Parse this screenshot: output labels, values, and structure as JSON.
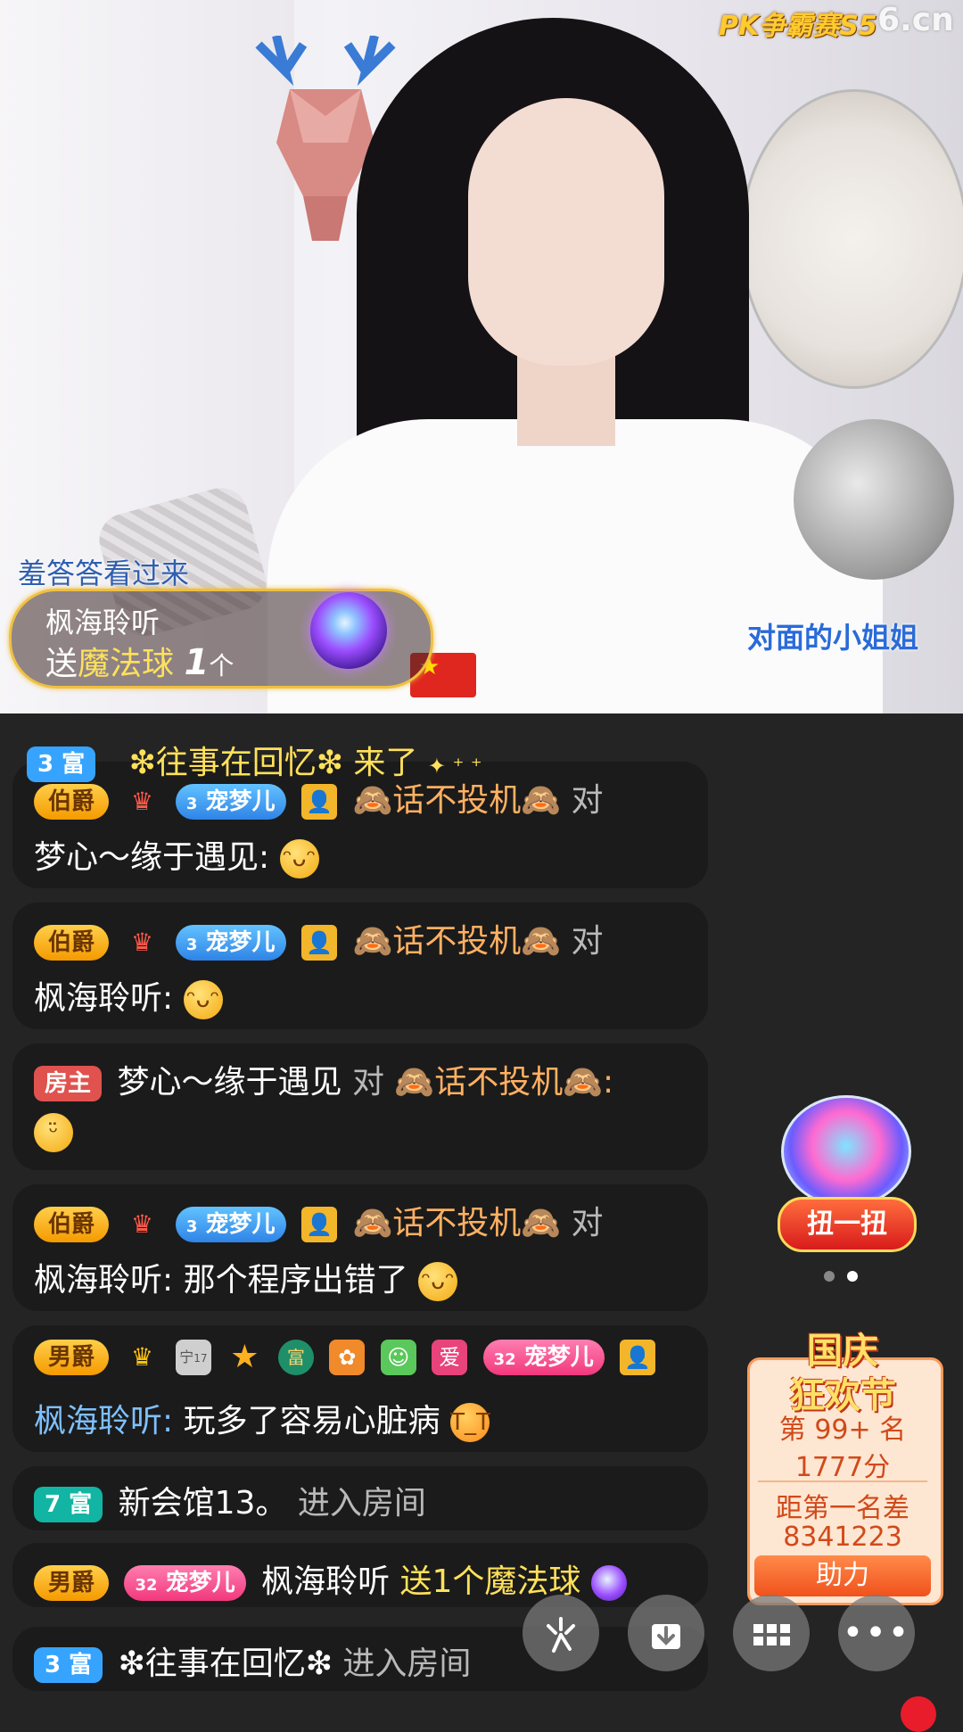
{
  "stream": {
    "pk_badge": "PK争霸赛S5",
    "site_logo": "6.cn",
    "watermark_left": "羞答答看过来",
    "watermark_right": "对面的小姐姐"
  },
  "gift_banner": {
    "sender": "枫海聆听",
    "verb": "送",
    "gift_name": "魔法球",
    "count": "1",
    "unit": "个"
  },
  "entry_banner": {
    "rich_level": "3 富",
    "user": "❇往事在回忆❇",
    "action": "来了"
  },
  "chat": {
    "m1": {
      "rank": "伯爵",
      "fan_badge": "宠梦儿",
      "fan_level": "3",
      "sender": "🙈话不投机🙈",
      "to": "对",
      "target": "梦心～缘于遇见:",
      "text": "",
      "emoji": "😁"
    },
    "m2": {
      "rank": "伯爵",
      "fan_badge": "宠梦儿",
      "fan_level": "3",
      "sender": "🙈话不投机🙈",
      "to": "对",
      "target": "枫海聆听:",
      "text": "",
      "emoji": "😁"
    },
    "m3": {
      "host": "房主",
      "sender": "梦心～缘于遇见",
      "to": "对",
      "target": "🙈话不投机🙈:",
      "emoji": "🤭"
    },
    "m4": {
      "rank": "伯爵",
      "fan_badge": "宠梦儿",
      "fan_level": "3",
      "sender": "🙈话不投机🙈",
      "to": "对",
      "target": "枫海聆听:",
      "text": "那个程序出错了",
      "emoji": "😁"
    },
    "m5": {
      "rank": "男爵",
      "shield_level": "17",
      "star_level": "1",
      "rich_medal": "富",
      "love_badge": "爱",
      "fan_badge": "宠梦儿",
      "fan_level": "32",
      "sender": "枫海聆听:",
      "text": "玩多了容易心脏病",
      "emoji": "😭"
    },
    "m6": {
      "rich_level": "7 富",
      "user": "新会馆13。",
      "action": "进入房间"
    },
    "m7": {
      "rank": "男爵",
      "fan_badge": "宠梦儿",
      "fan_level": "32",
      "sender": "枫海聆听",
      "action": "送1个魔法球"
    },
    "m8": {
      "rich_level": "3 富",
      "user": "❇往事在回忆❇",
      "action": "进入房间"
    }
  },
  "side": {
    "gashapon_label": "扭一扭",
    "event_title_1": "国庆",
    "event_title_2": "狂欢节",
    "event_rank": "第 99+ 名",
    "event_score": "1777分",
    "event_gap_label": "距第一名差",
    "event_gap": "8341223",
    "help_label": "助力"
  },
  "colors": {
    "accent_gold": "#ffe15a",
    "nick_orange": "#ffb062",
    "rich_blue": "#36a4ff",
    "host_red": "#e0524e"
  }
}
